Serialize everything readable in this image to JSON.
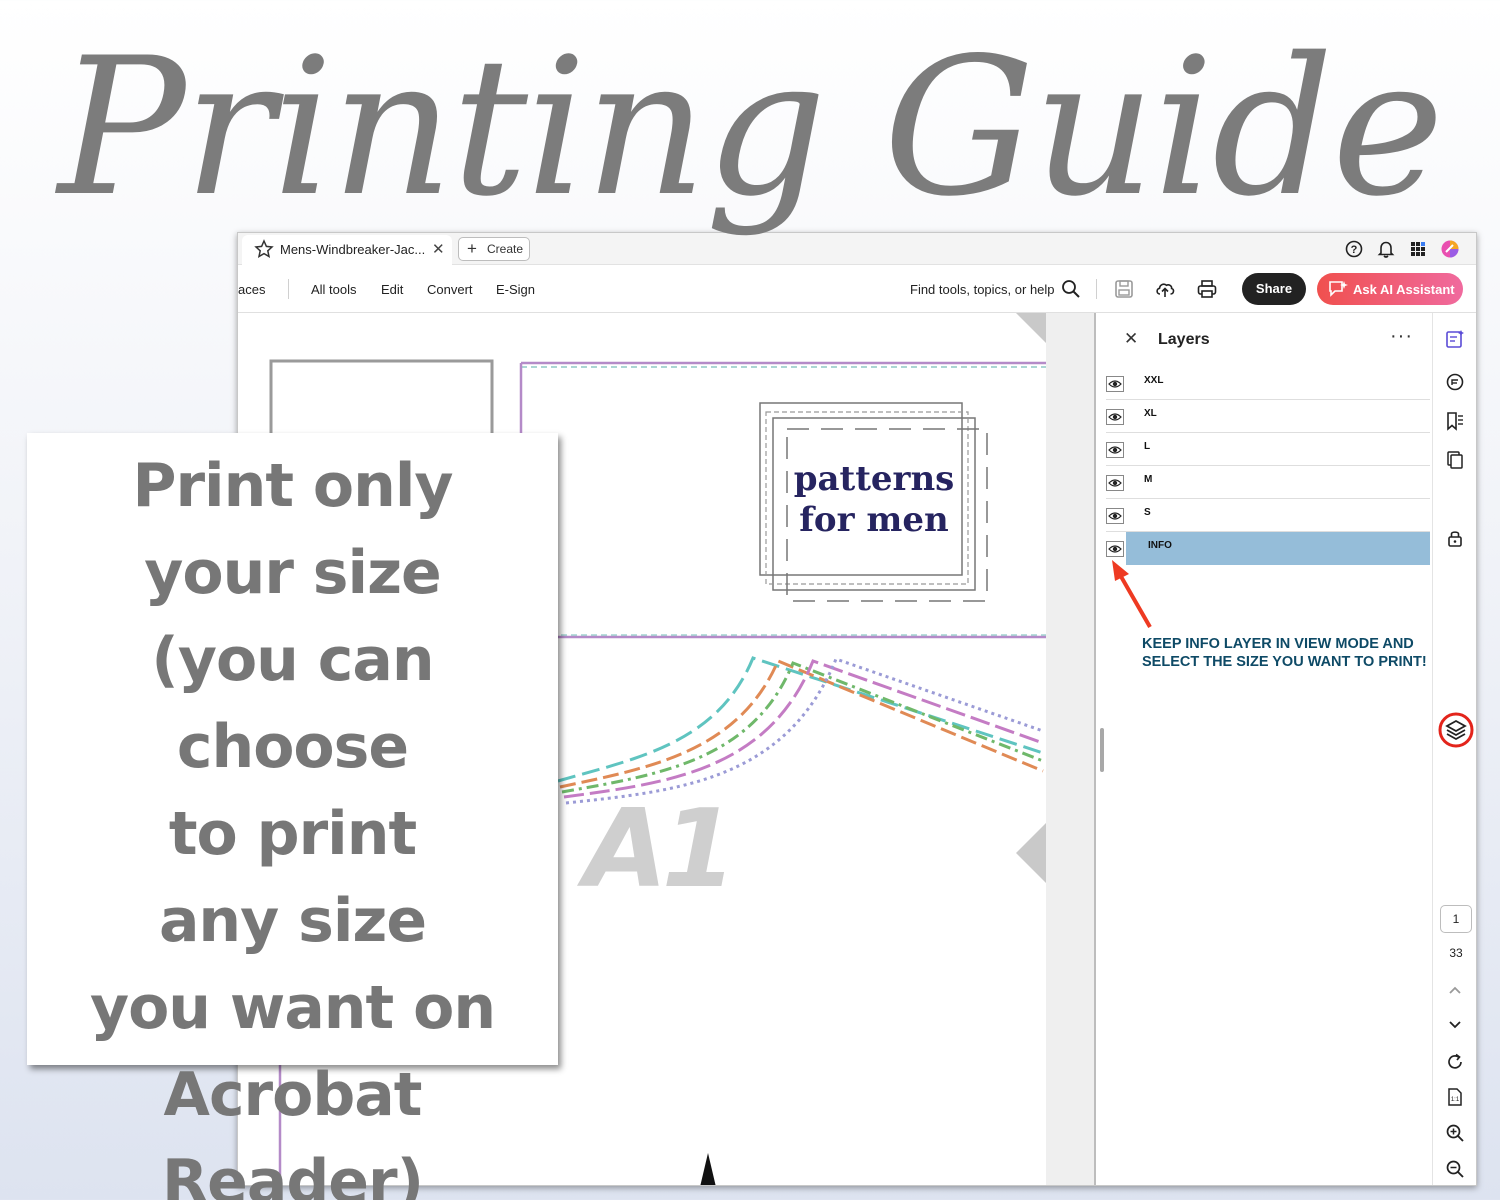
{
  "header": {
    "title": "Printing Guide"
  },
  "app": {
    "tab": {
      "label": "Mens-Windbreaker-Jac...",
      "close": "✕"
    },
    "create_label": "Create",
    "menu": {
      "left_cut": "aces",
      "items": [
        "All tools",
        "Edit",
        "Convert",
        "E-Sign"
      ]
    },
    "find_label": "Find tools, topics, or help",
    "share_label": "Share",
    "ai_label": "Ask AI Assistant",
    "icons": [
      "help-icon",
      "bell-icon",
      "apps-grid-icon",
      "profile-icon",
      "search-icon",
      "save-icon",
      "upload-cloud-icon",
      "printer-icon"
    ]
  },
  "document": {
    "logo_line1": "patterns",
    "logo_line2": "for men",
    "page_label": "A1",
    "line_colors": [
      "#5fc4c0",
      "#e08a55",
      "#6fb86a",
      "#c47cc4",
      "#9b9bd6"
    ]
  },
  "layers": {
    "title": "Layers",
    "close": "✕",
    "more": "···",
    "items": [
      {
        "label": "XXL",
        "visible": true,
        "selected": false
      },
      {
        "label": "XL",
        "visible": true,
        "selected": false
      },
      {
        "label": "L",
        "visible": true,
        "selected": false
      },
      {
        "label": "M",
        "visible": true,
        "selected": false
      },
      {
        "label": "S",
        "visible": true,
        "selected": false
      },
      {
        "label": "INFO",
        "visible": true,
        "selected": true
      }
    ],
    "note": "KEEP INFO LAYER IN VIEW MODE AND SELECT THE SIZE YOU WANT TO PRINT!",
    "selected_color": "#95bdd9",
    "arrow_color": "#ee3a22"
  },
  "rail": {
    "current_page": "1",
    "total_pages": "33"
  },
  "card": {
    "lines": [
      "Print only",
      "your size",
      "(you can choose",
      "to print",
      "any size",
      "you want on",
      "Acrobat Reader)"
    ]
  }
}
